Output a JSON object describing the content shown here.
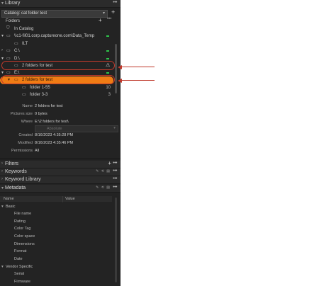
{
  "library": {
    "title": "Library",
    "catalog_label": "Catalog: cat folder test",
    "folders_label": "Folders",
    "tree": [
      {
        "label": "In Catalog",
        "indent": 1
      },
      {
        "label": "\\\\c1-fil01.corp.captureone.com\\Data_Temp",
        "indent": 1
      },
      {
        "label": "ILT",
        "indent": 3
      },
      {
        "label": "C:\\",
        "indent": 1
      },
      {
        "label": "D:\\",
        "indent": 1
      },
      {
        "label": "2 folders for test",
        "indent": 3,
        "warn": "⚠"
      },
      {
        "label": "E:\\",
        "indent": 1
      },
      {
        "label": "2 folders for test",
        "indent": 3
      },
      {
        "label": "folder 1-55",
        "count": "10",
        "indent": 5
      },
      {
        "label": "folder 3-3",
        "count": "3",
        "indent": 5
      }
    ],
    "properties": [
      {
        "key": "Name",
        "value": "2 folders for test"
      },
      {
        "key": "Pictures size",
        "value": "0 bytes"
      },
      {
        "key": "Where",
        "value": "E:\\2 folders for test\\"
      },
      {
        "key": "",
        "value": "Absolute"
      },
      {
        "key": "Created",
        "value": "8/16/2023 4:35:28 PM"
      },
      {
        "key": "Modified",
        "value": "8/16/2023 4:35:46 PM"
      },
      {
        "key": "Permissions",
        "value": "All"
      }
    ]
  },
  "filters": {
    "title": "Filters"
  },
  "keywords": {
    "title": "Keywords"
  },
  "keyword_library": {
    "title": "Keyword Library"
  },
  "metadata": {
    "title": "Metadata",
    "col_name": "Name",
    "col_value": "Value",
    "basic_label": "Basic",
    "basic_items": [
      "File name",
      "Rating",
      "Color Tag",
      "Color space",
      "Dimensions",
      "Format",
      "Date"
    ],
    "vendor_label": "Vendor Specific",
    "vendor_items": [
      "Serial",
      "Firmware"
    ]
  },
  "colors": {
    "accent_orange": "#f07c14",
    "annotation_red": "#c0392b",
    "status_green": "#2ec44a"
  },
  "icons": [
    "chevron-down-icon",
    "folder-icon",
    "drive-icon",
    "warning-icon",
    "plus-icon",
    "more-icon"
  ]
}
